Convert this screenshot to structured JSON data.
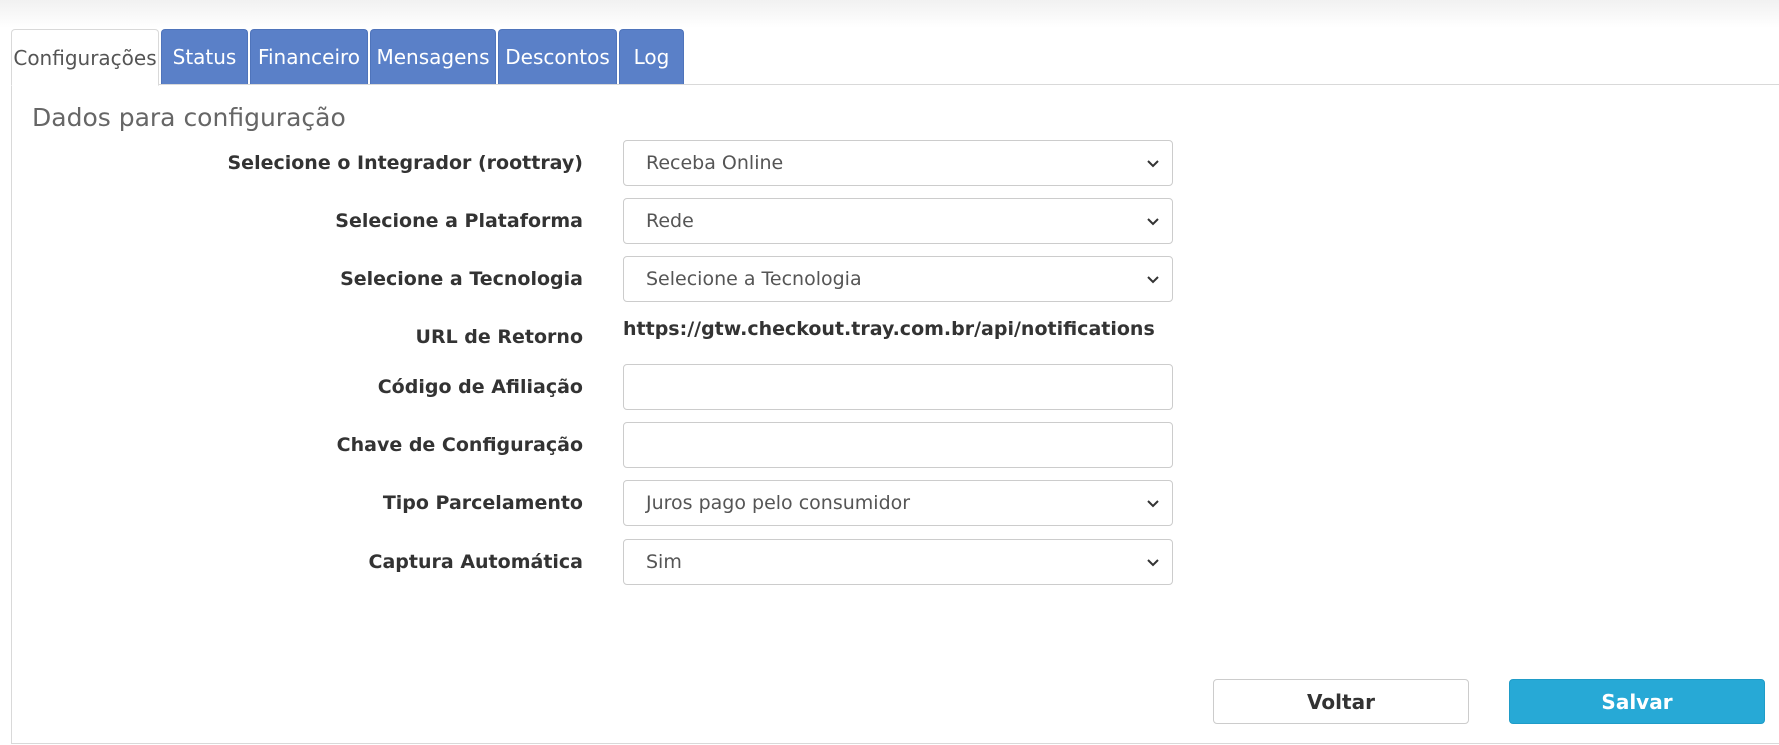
{
  "tabs": [
    {
      "label": "Configurações",
      "active": true
    },
    {
      "label": "Status",
      "active": false
    },
    {
      "label": "Financeiro",
      "active": false
    },
    {
      "label": "Mensagens",
      "active": false
    },
    {
      "label": "Descontos",
      "active": false
    },
    {
      "label": "Log",
      "active": false
    }
  ],
  "section_title": "Dados para configuração",
  "form": {
    "integrador": {
      "label": "Selecione o Integrador (roottray)",
      "value": "Receba Online"
    },
    "plataforma": {
      "label": "Selecione a Plataforma",
      "value": "Rede"
    },
    "tecnologia": {
      "label": "Selecione a Tecnologia",
      "value": "Selecione a Tecnologia"
    },
    "url_retorno": {
      "label": "URL de Retorno",
      "value": "https://gtw.checkout.tray.com.br/api/notifications"
    },
    "codigo_afiliacao": {
      "label": "Código de Afiliação",
      "value": ""
    },
    "chave_configuracao": {
      "label": "Chave de Configuração",
      "value": ""
    },
    "tipo_parcelamento": {
      "label": "Tipo Parcelamento",
      "value": "Juros pago pelo consumidor"
    },
    "captura_automatica": {
      "label": "Captura Automática",
      "value": "Sim"
    }
  },
  "buttons": {
    "back_label": "Voltar",
    "save_label": "Salvar"
  },
  "colors": {
    "tab_bg": "#5a80c8",
    "save_bg": "#27a9d6"
  },
  "icons": {
    "select_arrow": "chevron-down-icon"
  }
}
